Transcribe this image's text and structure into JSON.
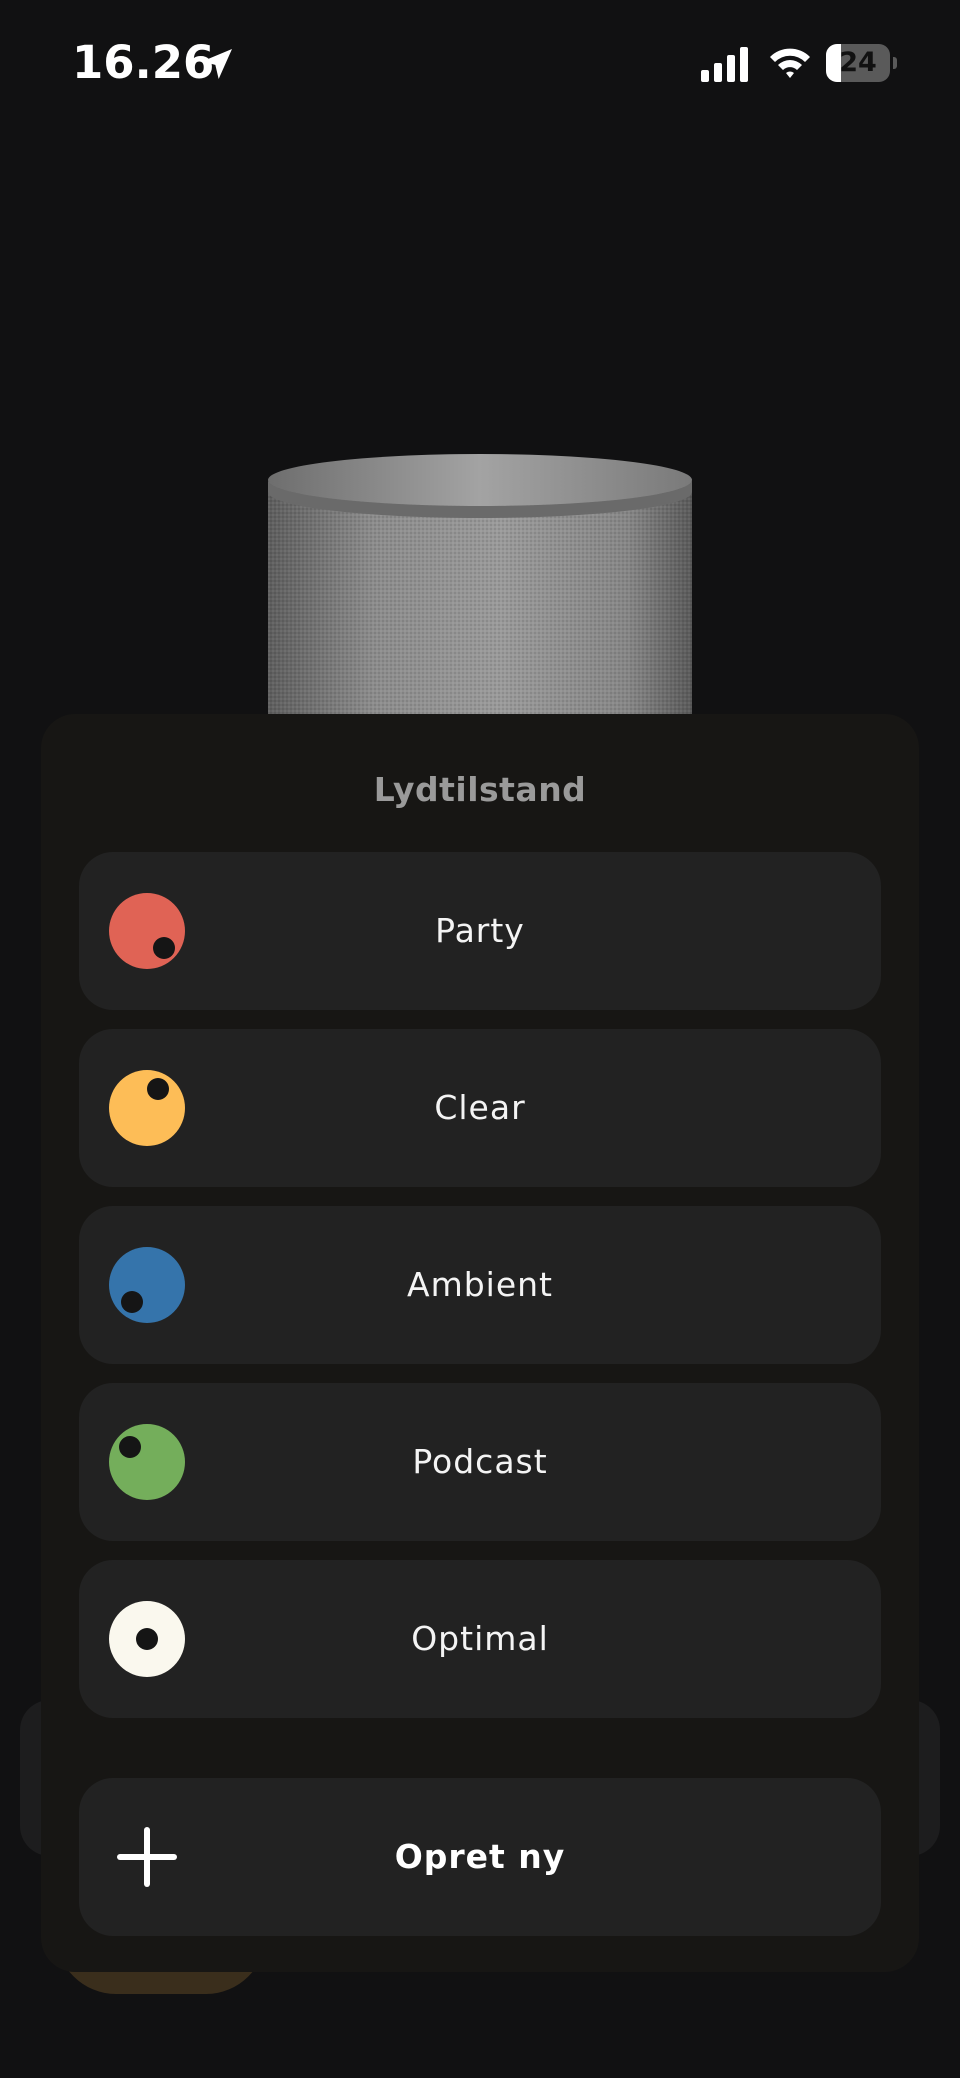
{
  "status_bar": {
    "time": "16.26",
    "battery_level": "24",
    "battery_fraction": 0.24,
    "icons": [
      "location-arrow-icon",
      "signal-icon",
      "wifi-icon",
      "battery-icon"
    ]
  },
  "sheet": {
    "title": "Lydtilstand",
    "modes": [
      {
        "label": "Party",
        "color": "#e06355",
        "icon": "party-dot-icon"
      },
      {
        "label": "Clear",
        "color": "#fdbd57",
        "icon": "clear-dot-icon"
      },
      {
        "label": "Ambient",
        "color": "#3574ab",
        "icon": "ambient-dot-icon"
      },
      {
        "label": "Podcast",
        "color": "#74ae5b",
        "icon": "podcast-dot-icon"
      },
      {
        "label": "Optimal",
        "color": "#faf8ee",
        "icon": "optimal-dot-icon"
      }
    ],
    "create_label": "Opret ny",
    "create_icon": "plus-icon"
  },
  "colors": {
    "background": "#111112",
    "sheet": "#171614",
    "row": "#222222",
    "title": "#9a9a9a"
  }
}
